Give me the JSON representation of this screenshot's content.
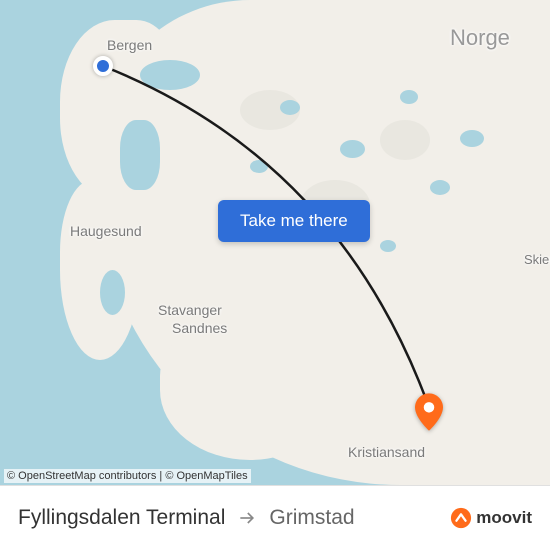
{
  "map": {
    "country_label": "Norge",
    "cities": {
      "bergen": "Bergen",
      "haugesund": "Haugesund",
      "stavanger": "Stavanger",
      "sandnes": "Sandnes",
      "kristiansand": "Kristiansand",
      "skien": "Skien"
    },
    "cta_label": "Take me there",
    "attribution": {
      "osm": "© OpenStreetMap contributors",
      "omt": "© OpenMapTiles"
    }
  },
  "route": {
    "origin": "Fyllingsdalen Terminal",
    "destination": "Grimstad"
  },
  "branding": {
    "logo_text": "moovit"
  }
}
